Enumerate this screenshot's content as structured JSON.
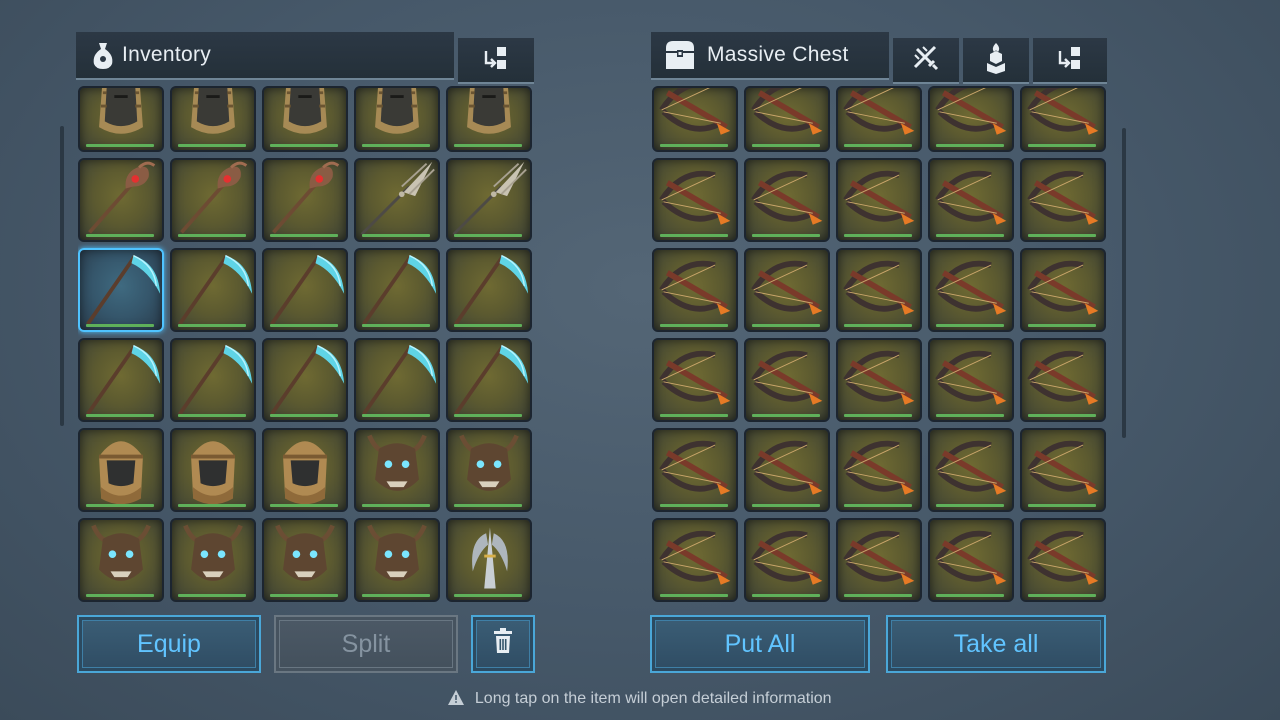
{
  "inventory": {
    "title": "Inventory",
    "icon": "money-bag-icon",
    "transfer_icon": "transfer-icon",
    "rows": [
      [
        "mummy-helmet",
        "mummy-helmet",
        "mummy-helmet",
        "mummy-helmet",
        "mummy-helmet"
      ],
      [
        "bone-staff",
        "bone-staff",
        "bone-staff",
        "trident-spear",
        "trident-spear"
      ],
      [
        "scythe",
        "scythe",
        "scythe",
        "scythe",
        "scythe"
      ],
      [
        "scythe",
        "scythe",
        "scythe",
        "scythe",
        "scythe"
      ],
      [
        "wrapped-helmet",
        "wrapped-helmet",
        "wrapped-helmet",
        "demon-mask",
        "demon-mask"
      ],
      [
        "demon-mask",
        "demon-mask",
        "demon-mask",
        "demon-mask",
        "winged-helmet"
      ]
    ],
    "selected_slot": [
      2,
      0
    ],
    "buttons": {
      "equip": "Equip",
      "split": "Split",
      "trash_icon": "trash-icon"
    }
  },
  "chest": {
    "title": "Massive Chest",
    "icon": "chest-icon",
    "header_icons": [
      "no-sword-icon",
      "fire-tower-icon",
      "transfer-icon"
    ],
    "rows": [
      [
        "crossbow",
        "crossbow",
        "crossbow",
        "crossbow",
        "crossbow"
      ],
      [
        "crossbow",
        "crossbow",
        "crossbow",
        "crossbow",
        "crossbow"
      ],
      [
        "crossbow",
        "crossbow",
        "crossbow",
        "crossbow",
        "crossbow"
      ],
      [
        "crossbow",
        "crossbow",
        "crossbow",
        "crossbow",
        "crossbow"
      ],
      [
        "crossbow",
        "crossbow",
        "crossbow",
        "crossbow",
        "crossbow"
      ],
      [
        "crossbow",
        "crossbow",
        "crossbow",
        "crossbow",
        "crossbow"
      ]
    ],
    "buttons": {
      "put_all": "Put All",
      "take_all": "Take all"
    }
  },
  "hint": {
    "icon": "warning-icon",
    "text": "Long tap on the item will open detailed information"
  },
  "colors": {
    "accent": "#61c4ff",
    "durability": "#5fb05a",
    "slot_gold": "#6f6a32"
  }
}
